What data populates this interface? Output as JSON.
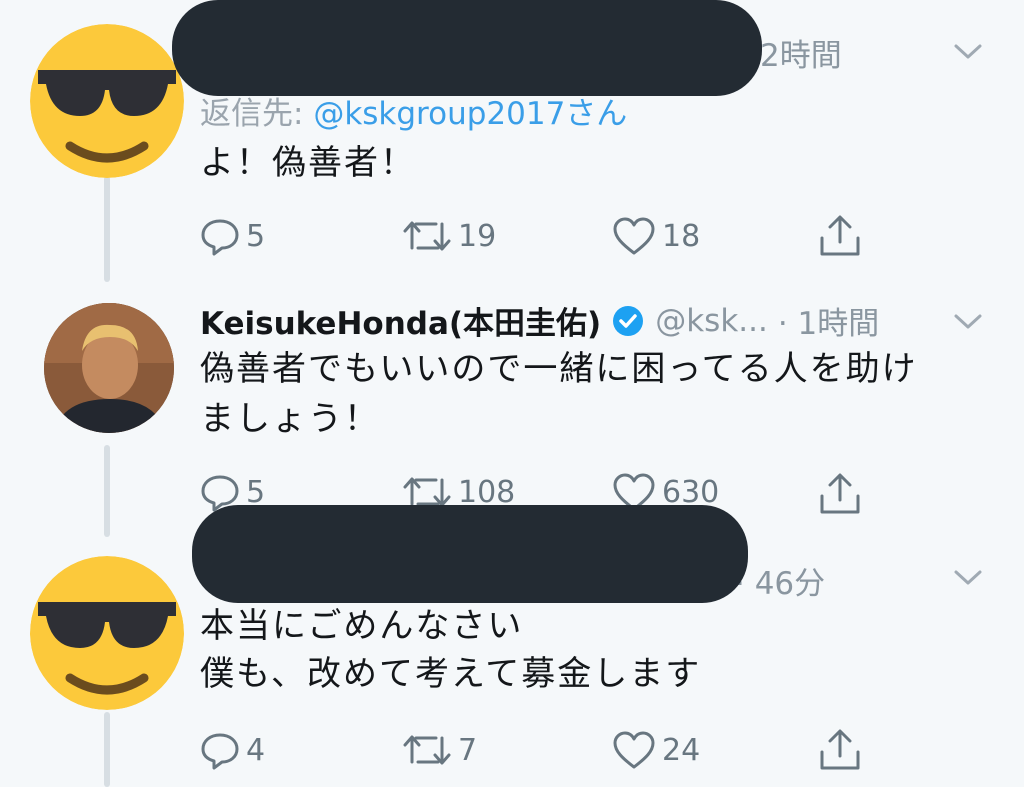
{
  "tweets": [
    {
      "time": "2時間",
      "reply_prefix": "返信先: ",
      "reply_handle": "@kskgroup2017",
      "reply_suffix": "さん",
      "lines": [
        "よ！偽善者！"
      ],
      "replies": "5",
      "retweets": "19",
      "likes": "18"
    },
    {
      "name": "KeisukeHonda(本田圭佑)",
      "handle": "@ksk...",
      "time": "· 1時間",
      "lines": [
        "偽善者でもいいので一緒に困ってる人を助け",
        "ましょう！"
      ],
      "replies": "5",
      "retweets": "108",
      "likes": "630"
    },
    {
      "time": "· 46分",
      "lines": [
        "本当にごめんなさい",
        "僕も、改めて考えて募金します"
      ],
      "replies": "4",
      "retweets": "7",
      "likes": "24"
    }
  ],
  "colors": {
    "background": "#f5f8fa",
    "link": "#3a9ee8",
    "verified": "#1da1f2",
    "muted": "#8a96a0",
    "redaction": "#232b33",
    "emoji_face": "#fcc93b"
  },
  "icons": [
    "sunglasses-emoji-avatar",
    "reply-icon",
    "retweet-icon",
    "like-icon",
    "share-icon",
    "chevron-down-icon",
    "verified-badge-icon"
  ]
}
